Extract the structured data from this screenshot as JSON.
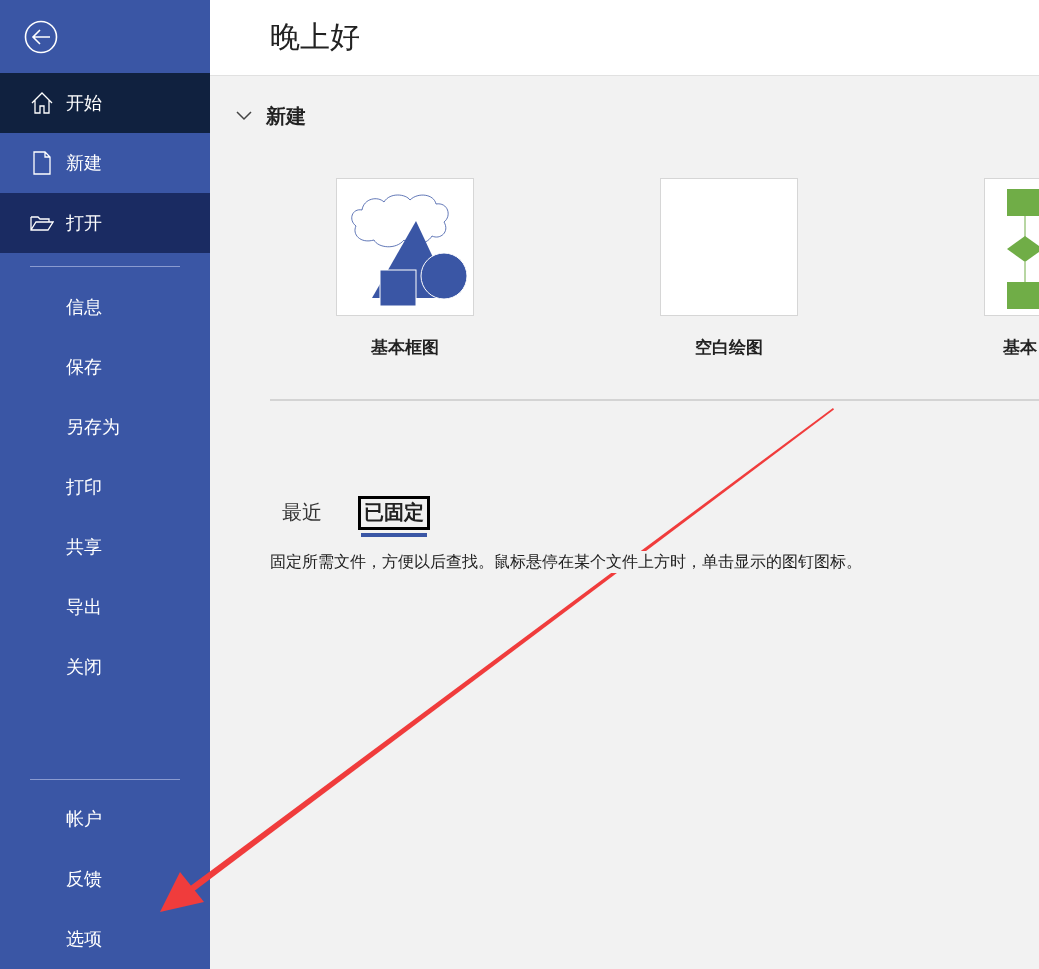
{
  "sidebar": {
    "primary": [
      {
        "label": "开始",
        "kind": "home",
        "selected": true,
        "hovered": false
      },
      {
        "label": "新建",
        "kind": "new",
        "selected": false,
        "hovered": false
      },
      {
        "label": "打开",
        "kind": "open",
        "selected": false,
        "hovered": true
      }
    ],
    "secondary": [
      {
        "label": "信息",
        "selected": false
      },
      {
        "label": "保存",
        "selected": false
      },
      {
        "label": "另存为",
        "selected": false
      },
      {
        "label": "打印",
        "selected": false
      },
      {
        "label": "共享",
        "selected": false
      },
      {
        "label": "导出",
        "selected": false
      },
      {
        "label": "关闭",
        "selected": false
      }
    ],
    "footer": [
      {
        "label": "帐户",
        "selected": false
      },
      {
        "label": "反馈",
        "selected": false
      },
      {
        "label": "选项",
        "selected": false
      }
    ]
  },
  "greeting": "晚上好",
  "new_section": {
    "title": "新建",
    "expanded": true,
    "templates": [
      {
        "label": "基本框图",
        "kind": "shapes"
      },
      {
        "label": "空白绘图",
        "kind": "blank"
      },
      {
        "label": "基本",
        "kind": "flowchart"
      }
    ]
  },
  "files": {
    "tabs": [
      {
        "label": "最近",
        "selected": false,
        "focused": false
      },
      {
        "label": "已固定",
        "selected": true,
        "focused": true
      }
    ],
    "message": "固定所需文件，方便以后查找。鼠标悬停在某个文件上方时，单击显示的图钉图标。"
  }
}
